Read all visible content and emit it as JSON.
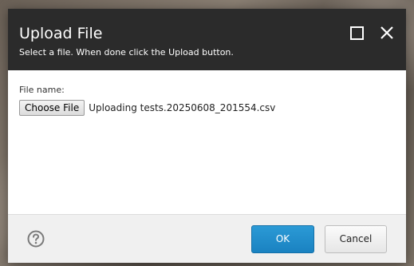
{
  "dialog": {
    "title": "Upload File",
    "subtitle": "Select a file. When done click the Upload button."
  },
  "header_controls": {
    "maximize_icon": "square-maximize-icon",
    "close_icon": "close-x-icon"
  },
  "form": {
    "file_name_label": "File name:",
    "choose_button_label": "Choose File",
    "file_status": "Uploading tests.20250608_201554.csv"
  },
  "footer": {
    "help_icon": "question-circle-icon",
    "ok_label": "OK",
    "cancel_label": "Cancel"
  },
  "colors": {
    "header_bg": "#2b2b2b",
    "ok_button": "#1f8dcc",
    "footer_bg": "#f0f0f0"
  }
}
